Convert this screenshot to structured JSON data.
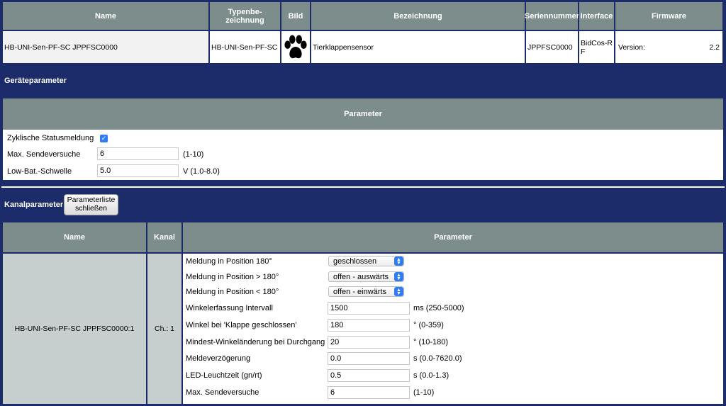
{
  "device_table": {
    "headers": {
      "name": "Name",
      "type": "Typenbe-\nzeichnung",
      "image": "Bild",
      "description": "Bezeichnung",
      "serial": "Seriennummer",
      "interface": "Interface",
      "firmware": "Firmware"
    },
    "row": {
      "name": "HB-UNI-Sen-PF-SC JPPFSC0000",
      "type": "HB-UNI-Sen-PF-SC",
      "image_icon": "paw-icon",
      "description": "Tierklappensensor",
      "serial": "JPPFSC0000",
      "interface": "BidCos-RF",
      "firmware_label": "Version:",
      "firmware_value": "2.2"
    }
  },
  "device_params": {
    "section_title": "Geräteparameter",
    "header": "Parameter",
    "cyclic_label": "Zyklische Statusmeldung",
    "cyclic_checked": true,
    "send_label": "Max. Sendeversuche",
    "send_value": "6",
    "send_hint": "(1-10)",
    "lowbat_label": "Low-Bat.-Schwelle",
    "lowbat_value": "5.0",
    "lowbat_hint": "V (1.0-8.0)"
  },
  "channel_params": {
    "section_title": "Kanalparameter",
    "close_button": "Parameterliste\nschließen",
    "headers": {
      "name": "Name",
      "channel": "Kanal",
      "parameter": "Parameter"
    },
    "name": "HB-UNI-Sen-PF-SC JPPFSC0000:1",
    "channel": "Ch.: 1",
    "rows": [
      {
        "label": "Meldung in Position 180°",
        "value": "geschlossen",
        "hint": ""
      },
      {
        "label": "Meldung in Position > 180°",
        "value": "offen - auswärts",
        "hint": ""
      },
      {
        "label": "Meldung in Position < 180°",
        "value": "offen - einwärts",
        "hint": ""
      },
      {
        "label": "Winkelerfassung Intervall",
        "value": "1500",
        "hint": "ms (250-5000)"
      },
      {
        "label": "Winkel bei 'Klappe geschlossen'",
        "value": "180",
        "hint": "° (0-359)"
      },
      {
        "label": "Mindest-Winkeländerung bei Durchgang",
        "value": "20",
        "hint": "° (10-180)"
      },
      {
        "label": "Meldeverzögerung",
        "value": "0.0",
        "hint": "s (0.0-7620.0)"
      },
      {
        "label": "LED-Leuchtzeit (gn/rt)",
        "value": "0.5",
        "hint": "s (0.0-1.3)"
      },
      {
        "label": "Max. Sendeversuche",
        "value": "6",
        "hint": "(1-10)"
      }
    ]
  }
}
